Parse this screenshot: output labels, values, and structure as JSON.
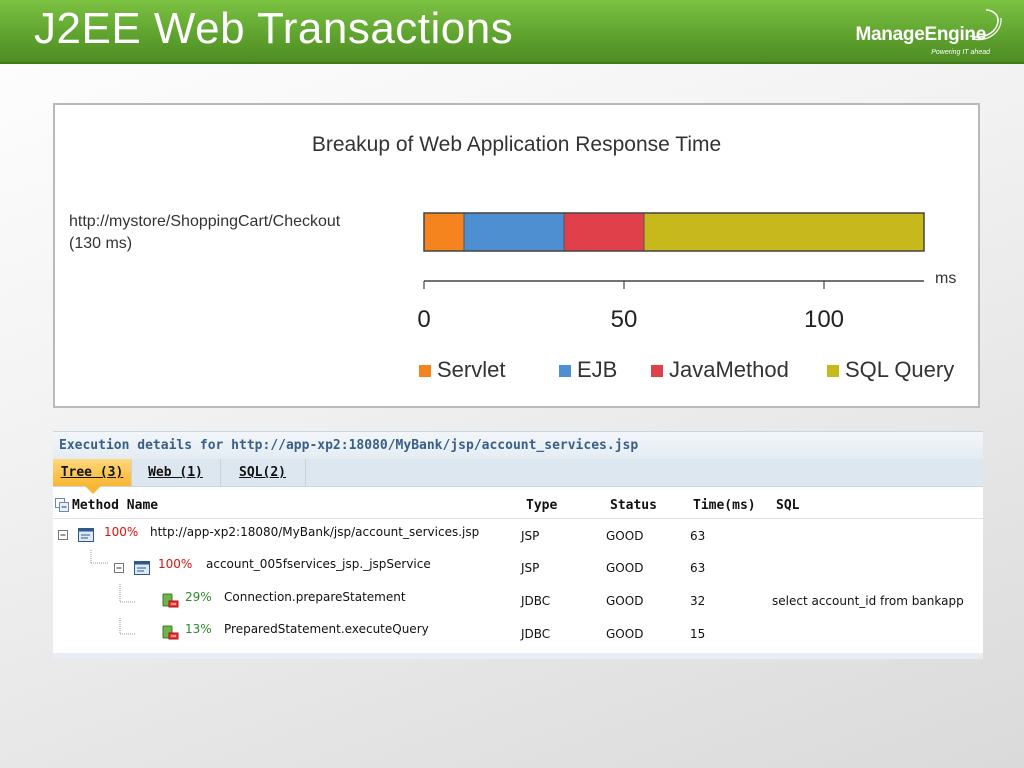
{
  "slide": {
    "title": "J2EE Web Transactions"
  },
  "brand": {
    "name": "ManageEngine",
    "tagline": "Powering IT ahead"
  },
  "chart_data": {
    "type": "bar",
    "orientation": "horizontal-stacked",
    "title": "Breakup of Web Application Response Time",
    "category_label": "http://mystore/ShoppingCart/Checkout",
    "category_sublabel": "(130 ms)",
    "xlabel": "ms",
    "xlim": [
      0,
      130
    ],
    "ticks": [
      0,
      50,
      100
    ],
    "grid": false,
    "legend_position": "bottom",
    "series": [
      {
        "name": "Servlet",
        "value": 10,
        "color": "#f5841f"
      },
      {
        "name": "EJB",
        "value": 25,
        "color": "#4d8fd1"
      },
      {
        "name": "JavaMethod",
        "value": 20,
        "color": "#e0404a"
      },
      {
        "name": "SQL Query",
        "value": 70,
        "color": "#c7b91b"
      }
    ]
  },
  "exec": {
    "header": "Execution details for http://app-xp2:18080/MyBank/jsp/account_services.jsp",
    "tabs": [
      {
        "label": "Tree (3)",
        "active": true
      },
      {
        "label": "Web (1)",
        "active": false
      },
      {
        "label": "SQL(2)",
        "active": false
      }
    ],
    "columns": {
      "method": "Method Name",
      "type": "Type",
      "status": "Status",
      "time": "Time(ms)",
      "sql": "SQL"
    },
    "rows": [
      {
        "pct": "100%",
        "name": "http://app-xp2:18080/MyBank/jsp/account_services.jsp",
        "type": "JSP",
        "status": "GOOD",
        "time": "63",
        "sql": ""
      },
      {
        "pct": "100%",
        "name": "account_005fservices_jsp._jspService",
        "type": "JSP",
        "status": "GOOD",
        "time": "63",
        "sql": ""
      },
      {
        "pct": "29%",
        "name": "Connection.prepareStatement",
        "type": "JDBC",
        "status": "GOOD",
        "time": "32",
        "sql": "select account_id from bankapp"
      },
      {
        "pct": "13%",
        "name": "PreparedStatement.executeQuery",
        "type": "JDBC",
        "status": "GOOD",
        "time": "15",
        "sql": ""
      }
    ]
  }
}
